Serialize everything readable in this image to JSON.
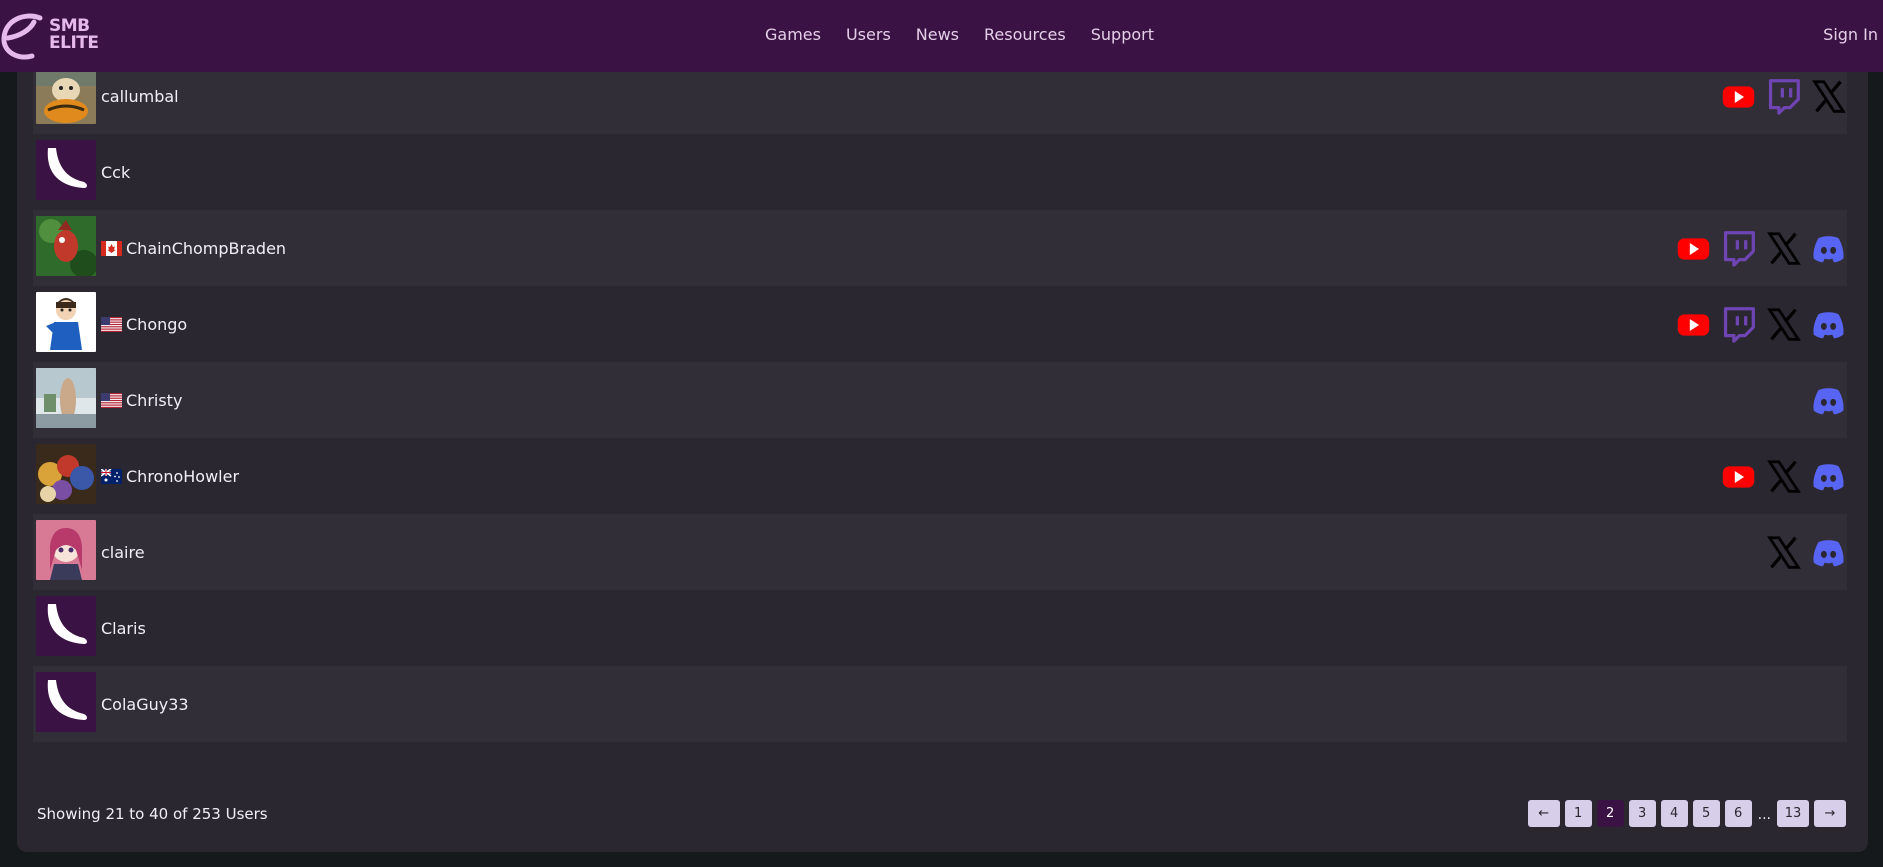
{
  "header": {
    "logo_text_line1": "SMB",
    "logo_text_line2": "ELITE",
    "nav": [
      "Games",
      "Users",
      "News",
      "Resources",
      "Support"
    ],
    "sign_in": "Sign In"
  },
  "users": [
    {
      "name": "callumbal",
      "flag": "",
      "avatar": "photo-dog",
      "socials": [
        "youtube-icon",
        "twitch-icon",
        "x-icon"
      ]
    },
    {
      "name": "Cck",
      "flag": "",
      "avatar": "banana",
      "socials": []
    },
    {
      "name": "ChainChompBraden",
      "flag": "canada",
      "avatar": "photo-creature",
      "socials": [
        "youtube-icon",
        "twitch-icon",
        "x-icon",
        "discord-icon"
      ]
    },
    {
      "name": "Chongo",
      "flag": "usa",
      "avatar": "photo-anime-boy",
      "socials": [
        "youtube-icon",
        "twitch-icon",
        "x-icon",
        "discord-icon"
      ]
    },
    {
      "name": "Christy",
      "flag": "usa",
      "avatar": "photo-figure",
      "socials": [
        "discord-icon"
      ]
    },
    {
      "name": "ChronoHowler",
      "flag": "australia",
      "avatar": "photo-plushies",
      "socials": [
        "youtube-icon",
        "x-icon",
        "discord-icon"
      ]
    },
    {
      "name": "claire",
      "flag": "",
      "avatar": "photo-anime-girl",
      "socials": [
        "x-icon",
        "discord-icon"
      ]
    },
    {
      "name": "Claris",
      "flag": "",
      "avatar": "banana",
      "socials": []
    },
    {
      "name": "ColaGuy33",
      "flag": "",
      "avatar": "banana",
      "socials": []
    }
  ],
  "footer": {
    "showing": "Showing 21 to 40 of 253 Users",
    "prev": "←",
    "pages": [
      "1",
      "2",
      "3",
      "4",
      "5",
      "6"
    ],
    "ellipsis": "...",
    "last_page": "13",
    "next": "→",
    "current_page": "2"
  },
  "colors": {
    "brand": "#3b1244",
    "youtube": "#ff0000",
    "twitch": "#6e45b3",
    "discord": "#5865f2"
  }
}
